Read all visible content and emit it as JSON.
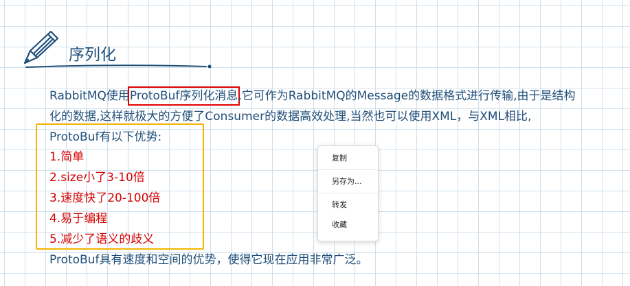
{
  "heading": {
    "title": "序列化"
  },
  "content": {
    "line1_pre": "RabbitMQ使用",
    "line1_highlight": "ProtoBuf序列化消息",
    "line1_post": ",它可作为RabbitMQ的Message的数据格式进行传输,由于是结构",
    "line2": "化的数据,这样就极大的方便了Consumer的数据高效处理,当然也可以使用XML，与XML相比,",
    "line3": "ProtoBuf有以下优势:",
    "advantages": [
      "1.简单",
      "2.size小了3-10倍",
      "3.速度快了20-100倍",
      "4.易于编程",
      "5.减少了语义的歧义"
    ],
    "conclusion": "ProtoBuf具有速度和空间的优势，使得它现在应用非常广泛。"
  },
  "context_menu": {
    "items": [
      {
        "label": "复制"
      },
      {
        "label": "另存为..."
      },
      {
        "label": "转发"
      },
      {
        "label": "收藏"
      }
    ]
  },
  "colors": {
    "text": "#1f4e79",
    "advantage": "#d40000",
    "highlight_box": "#e00000",
    "group_box": "#f4b400",
    "grid": "#cfe0ec"
  }
}
